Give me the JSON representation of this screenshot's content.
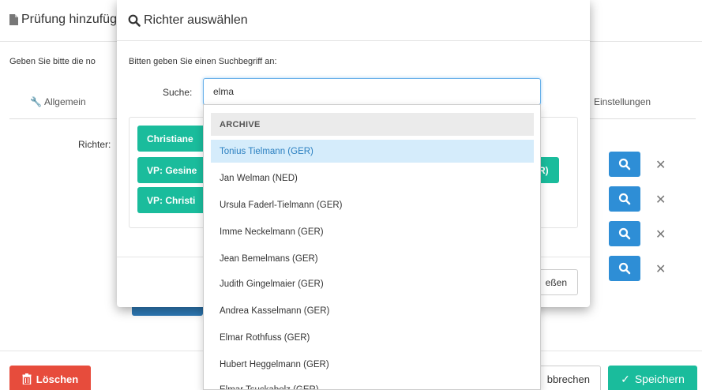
{
  "background": {
    "title": "Prüfung hinzufüg",
    "intro": "Geben Sie bitte die no",
    "tabs": [
      {
        "label": "Allgemein"
      },
      {
        "label": "Einstellungen"
      }
    ],
    "judges_label": "Richter:",
    "buttons": {
      "delete": "Löschen",
      "cancel": "bbrechen",
      "save": "Speichern"
    }
  },
  "modal": {
    "title": "Richter auswählen",
    "prompt": "Bitten geben Sie einen Suchbegriff an:",
    "search_label": "Suche:",
    "search_value": "elma",
    "chips": [
      "Christiane",
      "VP: Gesine",
      "VP: Christi"
    ],
    "chip_right": "R)",
    "close_label": "eßen"
  },
  "dropdown": {
    "group_label": "ARCHIVE",
    "items": [
      "Tonius Tielmann (GER)",
      "Jan Welman (NED)",
      "Ursula Faderl-Tielmann (GER)",
      "Imme Neckelmann (GER)",
      "Jean Bemelmans (GER)",
      "Judith Gingelmaier (GER)",
      "Andrea Kasselmann (GER)",
      "Elmar Rothfuss (GER)",
      "Hubert Heggelmann (GER)",
      "Elmar Tsuckabolz (GER)"
    ],
    "active_index": 0
  },
  "colors": {
    "teal": "#1abc9c",
    "blue": "#2e8ed6",
    "red": "#e74c3c",
    "active_bg": "#d5ecfb"
  }
}
